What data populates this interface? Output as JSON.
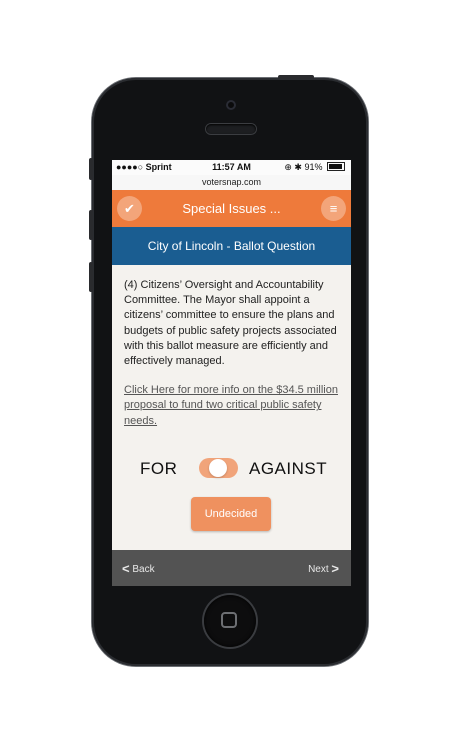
{
  "status_bar": {
    "carrier": "●●●●○ Sprint",
    "time": "11:57 AM",
    "battery": "91%"
  },
  "url": "votersnap.com",
  "header": {
    "title": "Special Issues ...",
    "check_icon": "check-icon",
    "menu_icon": "hamburger-menu-icon"
  },
  "subheader": {
    "title": "City of Lincoln - Ballot Question"
  },
  "content": {
    "paragraph": "(4) Citizens’ Oversight and Accountability Committee. The Mayor shall appoint a citizens’ committee to ensure the plans and budgets of public safety projects associated with this ballot measure are efficiently and effectively managed.",
    "link": "Click Here for more info on the $34.5 million proposal to fund two critical public safety needs."
  },
  "vote": {
    "for_label": "FOR",
    "against_label": "AGAINST",
    "undecided_label": "Undecided"
  },
  "footer": {
    "back_label": "Back",
    "next_label": "Next"
  },
  "colors": {
    "header": "#ee7a3b",
    "subheader": "#1a5d91",
    "toggle": "#f1a47a",
    "footer": "#535353"
  }
}
